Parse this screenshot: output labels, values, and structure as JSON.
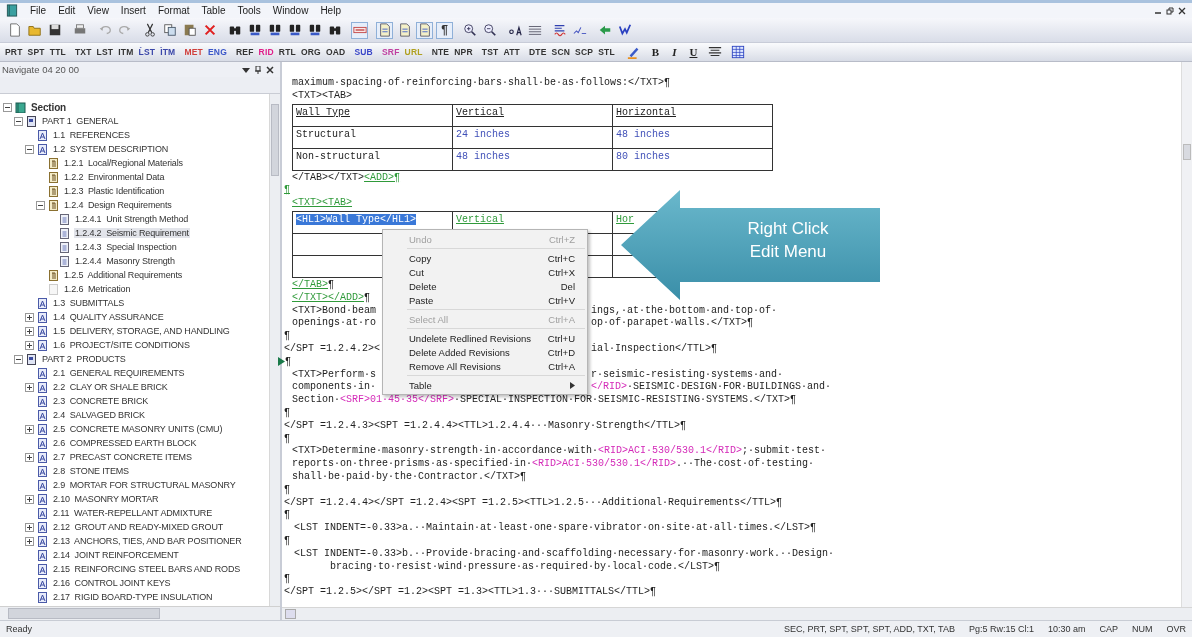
{
  "menu_bar": {
    "items": [
      "File",
      "Edit",
      "View",
      "Insert",
      "Format",
      "Table",
      "Tools",
      "Window",
      "Help"
    ]
  },
  "toolbar": {
    "groups": [
      [
        {
          "kind": "new",
          "pressed": false
        },
        {
          "kind": "open",
          "pressed": false
        },
        {
          "kind": "save",
          "pressed": false
        }
      ],
      [
        {
          "kind": "print",
          "pressed": false
        }
      ],
      [
        {
          "kind": "undo",
          "pressed": false
        },
        {
          "kind": "redo",
          "pressed": false
        }
      ],
      [
        {
          "kind": "cut",
          "pressed": false
        },
        {
          "kind": "copy",
          "pressed": false
        },
        {
          "kind": "paste",
          "pressed": false
        },
        {
          "kind": "delete",
          "pressed": false
        }
      ],
      [
        {
          "kind": "find",
          "pressed": false
        },
        {
          "kind": "find-alt",
          "pressed": false
        },
        {
          "kind": "find-alt",
          "pressed": false
        },
        {
          "kind": "find-alt",
          "pressed": false
        },
        {
          "kind": "find-alt",
          "pressed": false
        },
        {
          "kind": "find",
          "pressed": false
        }
      ],
      [
        {
          "kind": "tag",
          "pressed": true
        }
      ],
      [
        {
          "kind": "doc",
          "pressed": true
        },
        {
          "kind": "doc",
          "pressed": false
        },
        {
          "kind": "doc",
          "pressed": true
        },
        {
          "kind": "glyph",
          "label": "¶",
          "pressed": true
        }
      ],
      [
        {
          "kind": "zoom-in",
          "pressed": false
        },
        {
          "kind": "zoom-out",
          "pressed": false
        }
      ],
      [
        {
          "kind": "case",
          "pressed": false
        },
        {
          "kind": "lines",
          "pressed": false
        }
      ],
      [
        {
          "kind": "spell",
          "pressed": false
        },
        {
          "kind": "check",
          "pressed": false
        }
      ],
      [
        {
          "kind": "arrow",
          "pressed": false
        },
        {
          "kind": "check-blue",
          "pressed": false
        }
      ]
    ]
  },
  "tag_toolbar": {
    "groups": [
      [
        {
          "label": "PRT",
          "color": "#333333"
        },
        {
          "label": "SPT",
          "color": "#333333"
        },
        {
          "label": "TTL",
          "color": "#333333"
        }
      ],
      [
        {
          "label": "TXT",
          "color": "#333333"
        },
        {
          "label": "LST",
          "color": "#333333"
        },
        {
          "label": "ITM",
          "color": "#333333"
        },
        {
          "label": "ĹST",
          "color": "#3a46a8"
        },
        {
          "label": "ÌTM",
          "color": "#3a46a8"
        }
      ],
      [
        {
          "label": "MET",
          "color": "#d0403c"
        },
        {
          "label": "ENG",
          "color": "#3a56c8"
        }
      ],
      [
        {
          "label": "REF",
          "color": "#333333"
        },
        {
          "label": "RID",
          "color": "#e0208a"
        },
        {
          "label": "RTL",
          "color": "#333333"
        },
        {
          "label": "ORG",
          "color": "#333333"
        },
        {
          "label": "OAD",
          "color": "#333333"
        }
      ],
      [
        {
          "label": "SUB",
          "color": "#3a46c8"
        }
      ],
      [
        {
          "label": "SRF",
          "color": "#c040a0"
        },
        {
          "label": "URL",
          "color": "#b0a020"
        }
      ],
      [
        {
          "label": "NTE",
          "color": "#333333"
        },
        {
          "label": "NPR",
          "color": "#333333"
        }
      ],
      [
        {
          "label": "TST",
          "color": "#333333"
        },
        {
          "label": "ATT",
          "color": "#333333"
        }
      ],
      [
        {
          "label": "DTE",
          "color": "#333333"
        },
        {
          "label": "SCN",
          "color": "#333333"
        },
        {
          "label": "SCP",
          "color": "#333333"
        },
        {
          "label": "STL",
          "color": "#333333"
        }
      ]
    ],
    "format_buttons": [
      {
        "kind": "pen"
      },
      {
        "label": "B",
        "kind": "bold"
      },
      {
        "label": "I",
        "kind": "italic"
      },
      {
        "label": "U",
        "kind": "underline"
      },
      {
        "kind": "align"
      },
      {
        "kind": "table"
      }
    ]
  },
  "navigator": {
    "title": "Navigate 04 20 00",
    "tree": [
      {
        "kind": "section",
        "label": "Section",
        "expanded": true,
        "selected": false,
        "children": [
          {
            "kind": "part",
            "label": "PART 1  GENERAL",
            "expanded": true,
            "selected": false,
            "children": [
              {
                "kind": "article",
                "label": "1.1  REFERENCES",
                "selected": false
              },
              {
                "kind": "article",
                "label": "1.2  SYSTEM DESCRIPTION",
                "expanded": true,
                "selected": false,
                "children": [
                  {
                    "kind": "paragraph",
                    "label": "1.2.1  Local/Regional Materials",
                    "selected": false
                  },
                  {
                    "kind": "paragraph",
                    "label": "1.2.2  Environmental Data",
                    "selected": false
                  },
                  {
                    "kind": "paragraph",
                    "label": "1.2.3  Plastic Identification",
                    "selected": false
                  },
                  {
                    "kind": "paragraph",
                    "label": "1.2.4  Design Requirements",
                    "expanded": true,
                    "selected": false,
                    "children": [
                      {
                        "kind": "subparagraph",
                        "label": "1.2.4.1  Unit Strength Method",
                        "selected": false
                      },
                      {
                        "kind": "subparagraph",
                        "label": "1.2.4.2  Seismic Requirement",
                        "selected": true
                      },
                      {
                        "kind": "subparagraph",
                        "label": "1.2.4.3  Special Inspection",
                        "selected": false
                      },
                      {
                        "kind": "subparagraph",
                        "label": "1.2.4.4  Masonry Strength",
                        "selected": false
                      }
                    ]
                  },
                  {
                    "kind": "paragraph",
                    "label": "1.2.5  Additional Requirements",
                    "selected": false
                  },
                  {
                    "kind": "blank",
                    "label": "1.2.6  Metrication",
                    "selected": false
                  }
                ]
              },
              {
                "kind": "article",
                "label": "1.3  SUBMITTALS",
                "selected": false
              },
              {
                "kind": "article",
                "label": "1.4  QUALITY ASSURANCE",
                "expanded": false,
                "selected": false
              },
              {
                "kind": "article",
                "label": "1.5  DELIVERY, STORAGE, AND HANDLING",
                "expanded": false,
                "selected": false
              },
              {
                "kind": "article",
                "label": "1.6  PROJECT/SITE CONDITIONS",
                "expanded": false,
                "selected": false
              }
            ]
          },
          {
            "kind": "part",
            "label": "PART 2  PRODUCTS",
            "expanded": true,
            "selected": false,
            "children": [
              {
                "kind": "article",
                "label": "2.1  GENERAL REQUIREMENTS",
                "selected": false
              },
              {
                "kind": "article",
                "label": "2.2  CLAY OR SHALE BRICK",
                "expanded": false,
                "selected": false
              },
              {
                "kind": "article",
                "label": "2.3  CONCRETE BRICK",
                "selected": false
              },
              {
                "kind": "article",
                "label": "2.4  SALVAGED BRICK",
                "selected": false
              },
              {
                "kind": "article",
                "label": "2.5  CONCRETE MASONRY UNITS (CMU)",
                "expanded": false,
                "selected": false
              },
              {
                "kind": "article",
                "label": "2.6  COMPRESSED EARTH BLOCK",
                "selected": false
              },
              {
                "kind": "article",
                "label": "2.7  PRECAST CONCRETE ITEMS",
                "expanded": false,
                "selected": false
              },
              {
                "kind": "article",
                "label": "2.8  STONE ITEMS",
                "selected": false
              },
              {
                "kind": "article",
                "label": "2.9  MORTAR FOR STRUCTURAL MASONRY",
                "selected": false
              },
              {
                "kind": "article",
                "label": "2.10  MASONRY MORTAR",
                "expanded": false,
                "selected": false
              },
              {
                "kind": "article",
                "label": "2.11  WATER-REPELLANT ADMIXTURE",
                "selected": false
              },
              {
                "kind": "article",
                "label": "2.12  GROUT AND READY-MIXED GROUT",
                "expanded": false,
                "selected": false
              },
              {
                "kind": "article",
                "label": "2.13  ANCHORS, TIES, AND BAR POSITIONER",
                "expanded": false,
                "selected": false
              },
              {
                "kind": "article",
                "label": "2.14  JOINT REINFORCEMENT",
                "selected": false
              },
              {
                "kind": "article",
                "label": "2.15  REINFORCING STEEL BARS AND RODS",
                "selected": false
              },
              {
                "kind": "article",
                "label": "2.16  CONTROL JOINT KEYS",
                "selected": false
              },
              {
                "kind": "article",
                "label": "2.17  RIGID BOARD-TYPE INSULATION",
                "selected": false
              }
            ]
          }
        ]
      }
    ]
  },
  "editor": {
    "lines": [
      {
        "kind": "inner",
        "segments": [
          {
            "kind": "plain",
            "text": "maximum·spacing·of·reinforcing·bars·shall·be·as·follows:</TXT>¶"
          }
        ]
      },
      {
        "kind": "inner",
        "segments": [
          {
            "kind": "plain",
            "text": "<TXT><TAB>"
          }
        ]
      },
      {
        "kind": "table",
        "rows": [
          {
            "cells": [
              {
                "kind": "header",
                "text": "Wall Type"
              },
              {
                "kind": "header",
                "text": "Vertical"
              },
              {
                "kind": "header",
                "text": "Horizontal"
              }
            ]
          },
          {
            "cells": [
              {
                "kind": "plain",
                "text": "Structural"
              },
              {
                "kind": "value",
                "text": "24 inches"
              },
              {
                "kind": "value",
                "text": "48 inches"
              }
            ]
          },
          {
            "cells": [
              {
                "kind": "plain",
                "text": "Non-structural"
              },
              {
                "kind": "value",
                "text": "48 inches"
              },
              {
                "kind": "value",
                "text": "80 inches"
              }
            ]
          }
        ]
      },
      {
        "kind": "inner",
        "segments": [
          {
            "kind": "plain",
            "text": "</TAB></TXT>"
          },
          {
            "kind": "added",
            "text": "<ADD>¶"
          }
        ]
      },
      {
        "kind": "outer",
        "segments": [
          {
            "kind": "added",
            "text": "¶"
          }
        ]
      },
      {
        "kind": "inner",
        "segments": [
          {
            "kind": "added",
            "text": "<TXT><TAB>"
          }
        ]
      },
      {
        "kind": "table",
        "rows": [
          {
            "cells": [
              {
                "kind": "selected",
                "text": "<HL1>Wall Type</HL1>"
              },
              {
                "kind": "added",
                "text": "Vertical"
              },
              {
                "kind": "added",
                "text": "Hor"
              }
            ]
          },
          {
            "cells": [
              {},
              {},
              {}
            ]
          },
          {
            "cells": [
              {},
              {},
              {}
            ]
          }
        ]
      },
      {
        "kind": "inner",
        "segments": [
          {
            "kind": "added",
            "text": "</TAB>"
          },
          {
            "kind": "plain",
            "text": "¶"
          }
        ]
      },
      {
        "kind": "inner",
        "segments": [
          {
            "kind": "added",
            "text": "</TXT></ADD>"
          },
          {
            "kind": "plain",
            "text": "¶"
          }
        ]
      },
      {
        "kind": "inner",
        "segments": [
          {
            "kind": "plain",
            "text": "<TXT>Bond·beam"
          }
        ],
        "after_menu": [
          {
            "kind": "plain",
            "text": "ings,·at·the·bottom·and·top·of·"
          }
        ]
      },
      {
        "kind": "inner",
        "segments": [
          {
            "kind": "plain",
            "text": "openings·at·ro"
          }
        ],
        "after_menu": [
          {
            "kind": "plain",
            "text": "op·of·parapet·walls.</TXT>¶"
          }
        ]
      },
      {
        "kind": "outer",
        "segments": [
          {
            "kind": "plain",
            "text": "¶"
          }
        ]
      },
      {
        "kind": "outer",
        "segments": [
          {
            "kind": "plain",
            "text": "</SPT =1.2.4.2><"
          }
        ],
        "after_menu": [
          {
            "kind": "plain",
            "text": "ial·Inspection</TTL>¶"
          }
        ]
      },
      {
        "kind": "outer",
        "bookmark": true,
        "segments": [
          {
            "kind": "plain",
            "text": "¶"
          }
        ]
      },
      {
        "kind": "inner",
        "segments": [
          {
            "kind": "plain",
            "text": "<TXT>Perform·s"
          }
        ],
        "after_menu": [
          {
            "kind": "plain",
            "text": "r·seismic-resisting·systems·and·"
          }
        ]
      },
      {
        "kind": "inner",
        "segments": [
          {
            "kind": "plain",
            "text": "components·in·"
          }
        ],
        "after_menu": [
          {
            "kind": "ref",
            "text": "</RID>"
          },
          {
            "kind": "plain",
            "text": "·SEISMIC·DESIGN·FOR·BUILDINGS·and·"
          }
        ]
      },
      {
        "kind": "inner",
        "segments": [
          {
            "kind": "plain",
            "text": "Section·"
          },
          {
            "kind": "ref",
            "text": "<SRF>01·45·35</SRF>"
          },
          {
            "kind": "plain",
            "text": "·SPECIAL·INSPECTION·FOR·SEISMIC-RESISTING·SYSTEMS.</TXT>¶"
          }
        ]
      },
      {
        "kind": "outer",
        "segments": [
          {
            "kind": "plain",
            "text": "¶"
          }
        ]
      },
      {
        "kind": "outer",
        "segments": [
          {
            "kind": "plain",
            "text": "</SPT =1.2.4.3><SPT =1.2.4.4><TTL>1.2.4.4···Masonry·Strength</TTL>¶"
          }
        ]
      },
      {
        "kind": "outer",
        "segments": [
          {
            "kind": "plain",
            "text": "¶"
          }
        ]
      },
      {
        "kind": "inner",
        "segments": [
          {
            "kind": "plain",
            "text": "<TXT>Determine·masonry·strength·in·accordance·with·"
          },
          {
            "kind": "ref",
            "text": "<RID>ACI·530/530.1</RID>"
          },
          {
            "kind": "plain",
            "text": ";·submit·test·"
          }
        ]
      },
      {
        "kind": "inner",
        "segments": [
          {
            "kind": "plain",
            "text": "reports·on·three·prisms·as·specified·in·"
          },
          {
            "kind": "ref",
            "text": "<RID>ACI·530/530.1</RID>"
          },
          {
            "kind": "plain",
            "text": ".··The·cost·of·testing·"
          }
        ]
      },
      {
        "kind": "inner",
        "segments": [
          {
            "kind": "plain",
            "text": "shall·be·paid·by·the·Contractor.</TXT>¶"
          }
        ]
      },
      {
        "kind": "outer",
        "segments": [
          {
            "kind": "plain",
            "text": "¶"
          }
        ]
      },
      {
        "kind": "outer",
        "segments": [
          {
            "kind": "plain",
            "text": "</SPT =1.2.4.4></SPT =1.2.4><SPT =1.2.5><TTL>1.2.5···Additional·Requirements</TTL>¶"
          }
        ]
      },
      {
        "kind": "outer",
        "segments": [
          {
            "kind": "plain",
            "text": "¶"
          }
        ]
      },
      {
        "kind": "list",
        "segments": [
          {
            "kind": "plain",
            "text": "<LST INDENT=-0.33>a.··Maintain·at·least·one·spare·vibrator·on·site·at·all·times.</LST>¶"
          }
        ]
      },
      {
        "kind": "outer",
        "segments": [
          {
            "kind": "plain",
            "text": "¶"
          }
        ]
      },
      {
        "kind": "list",
        "segments": [
          {
            "kind": "plain",
            "text": "<LST INDENT=-0.33>b.··Provide·bracing·and·scaffolding·necessary·for·masonry·work.··Design·"
          }
        ]
      },
      {
        "kind": "continued",
        "segments": [
          {
            "kind": "plain",
            "text": "bracing·to·resist·wind·pressure·as·required·by·local·code.</LST>¶"
          }
        ]
      },
      {
        "kind": "outer",
        "segments": [
          {
            "kind": "plain",
            "text": "¶"
          }
        ]
      },
      {
        "kind": "outer",
        "segments": [
          {
            "kind": "plain",
            "text": "</SPT =1.2.5></SPT =1.2><SPT =1.3><TTL>1.3···SUBMITTALS</TTL>¶"
          }
        ]
      }
    ]
  },
  "context_menu": {
    "items": [
      {
        "kind": "command",
        "label": "Undo",
        "shortcut": "Ctrl+Z",
        "disabled": true
      },
      {
        "kind": "separator"
      },
      {
        "kind": "command",
        "label": "Copy",
        "shortcut": "Ctrl+C",
        "disabled": false
      },
      {
        "kind": "command",
        "label": "Cut",
        "shortcut": "Ctrl+X",
        "disabled": false
      },
      {
        "kind": "command",
        "label": "Delete",
        "shortcut": "Del",
        "disabled": false
      },
      {
        "kind": "command",
        "label": "Paste",
        "shortcut": "Ctrl+V",
        "disabled": false
      },
      {
        "kind": "separator"
      },
      {
        "kind": "command",
        "label": "Select All",
        "shortcut": "Ctrl+A",
        "disabled": true
      },
      {
        "kind": "separator"
      },
      {
        "kind": "command",
        "label": "Undelete Redlined Revisions",
        "shortcut": "Ctrl+U",
        "disabled": false
      },
      {
        "kind": "command",
        "label": "Delete Added Revisions",
        "shortcut": "Ctrl+D",
        "disabled": false
      },
      {
        "kind": "command",
        "label": "Remove All Revisions",
        "shortcut": "Ctrl+A",
        "disabled": false
      },
      {
        "kind": "separator"
      },
      {
        "kind": "submenu",
        "label": "Table",
        "disabled": false
      }
    ]
  },
  "callout": {
    "text": "Right Click\nEdit Menu"
  },
  "status_bar": {
    "message": "Ready",
    "fields": [
      "SEC, PRT, SPT, SPT, SPT, ADD, TXT, TAB",
      "Pg:5 Rw:15 Cl:1",
      "10:30 am",
      "CAP",
      "NUM",
      "OVR"
    ]
  }
}
